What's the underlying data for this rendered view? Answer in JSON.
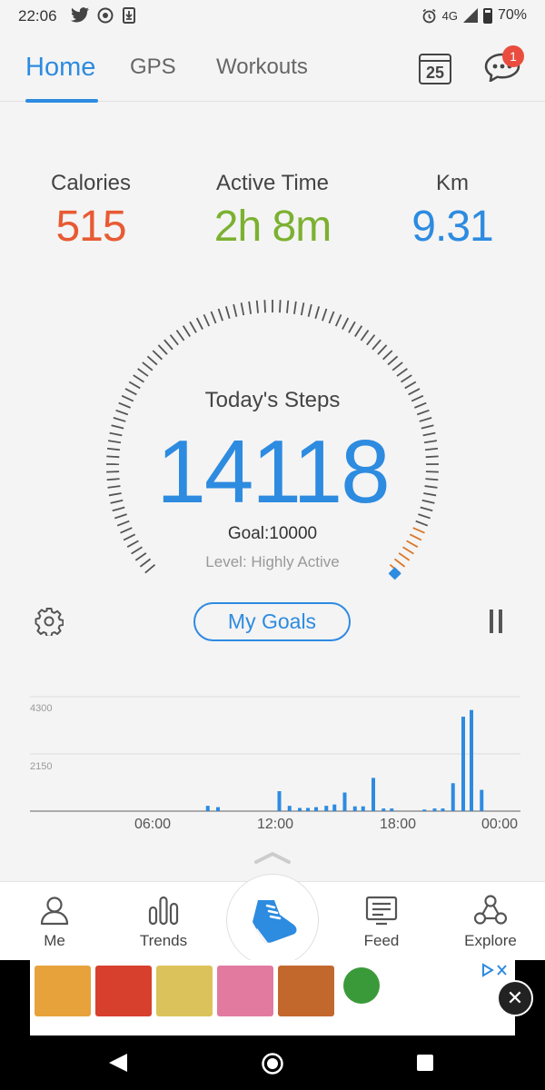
{
  "status_bar": {
    "time": "22:06",
    "network": "4G",
    "battery": "70%"
  },
  "tabs": [
    {
      "label": "Home",
      "active": true
    },
    {
      "label": "GPS",
      "active": false
    },
    {
      "label": "Workouts",
      "active": false
    }
  ],
  "header": {
    "calendar_day": "25",
    "notification_count": "1"
  },
  "stats": {
    "calories": {
      "label": "Calories",
      "value": "515",
      "color": "#e85a33"
    },
    "active_time": {
      "label": "Active Time",
      "value": "2h 8m",
      "color": "#7cb131"
    },
    "km": {
      "label": "Km",
      "value": "9.31",
      "color": "#2d8be0"
    }
  },
  "steps": {
    "label": "Today's Steps",
    "value": "14118",
    "goal": "Goal:10000",
    "level": "Level: Highly Active",
    "goal_fraction": 1.0
  },
  "buttons": {
    "my_goals": "My Goals"
  },
  "chart_data": {
    "type": "bar",
    "x_ticks": [
      "06:00",
      "12:00",
      "18:00",
      "00:00"
    ],
    "y_ticks": [
      "4300",
      "2150"
    ],
    "ylim": [
      0,
      4300
    ],
    "grid": true,
    "bar_color": "#2d8be0",
    "bars": [
      {
        "x": 8.7,
        "v": 200
      },
      {
        "x": 9.2,
        "v": 150
      },
      {
        "x": 12.2,
        "v": 750
      },
      {
        "x": 12.7,
        "v": 200
      },
      {
        "x": 13.2,
        "v": 120
      },
      {
        "x": 13.6,
        "v": 120
      },
      {
        "x": 14.0,
        "v": 150
      },
      {
        "x": 14.5,
        "v": 200
      },
      {
        "x": 14.9,
        "v": 250
      },
      {
        "x": 15.4,
        "v": 700
      },
      {
        "x": 15.9,
        "v": 180
      },
      {
        "x": 16.3,
        "v": 180
      },
      {
        "x": 16.8,
        "v": 1250
      },
      {
        "x": 17.3,
        "v": 100
      },
      {
        "x": 17.7,
        "v": 100
      },
      {
        "x": 19.3,
        "v": 60
      },
      {
        "x": 19.8,
        "v": 100
      },
      {
        "x": 20.2,
        "v": 100
      },
      {
        "x": 20.7,
        "v": 1050
      },
      {
        "x": 21.2,
        "v": 3550
      },
      {
        "x": 21.6,
        "v": 3800
      },
      {
        "x": 22.1,
        "v": 800
      }
    ]
  },
  "bottom_nav": [
    {
      "label": "Me",
      "icon": "person-icon"
    },
    {
      "label": "Trends",
      "icon": "bar-chart-icon"
    },
    {
      "label": "",
      "icon": "shoe-icon"
    },
    {
      "label": "Feed",
      "icon": "feed-icon"
    },
    {
      "label": "Explore",
      "icon": "explore-icon"
    }
  ],
  "ad": {
    "thumb_colors": [
      "#e8a23c",
      "#d8402e",
      "#dcc25a",
      "#e27aa0",
      "#c3682d",
      "#3a9a3a"
    ]
  }
}
